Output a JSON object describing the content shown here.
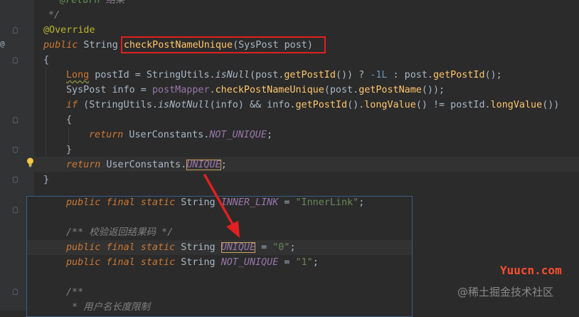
{
  "code": {
    "l0_prefix": "* ",
    "l0_tag": "@return",
    "l0_text": " 结果",
    "l1": "*/",
    "l2_ann": "@Override",
    "l3_kw": "public",
    "l3_type": " String ",
    "l3_method": "checkPostNameUnique",
    "l3_params": "(SysPost post)",
    "l4": "{",
    "l5_type": "Long",
    "l5_a": " postId = StringUtils.",
    "l5_isnull": "isNull",
    "l5_b": "(post.",
    "l5_getpostid1": "getPostId",
    "l5_c": "()) ? ",
    "l5_num": "-1L",
    "l5_d": " : post.",
    "l5_getpostid2": "getPostId",
    "l5_e": "();",
    "l6_a": "SysPost info = ",
    "l6_field": "postMapper",
    "l6_b": ".",
    "l6_method": "checkPostNameUnique",
    "l6_c": "(post.",
    "l6_getname": "getPostName",
    "l6_d": "());",
    "l7_kw": "if",
    "l7_a": " (StringUtils.",
    "l7_isnotnull": "isNotNull",
    "l7_b": "(info) && info.",
    "l7_getpostid": "getPostId",
    "l7_c": "().",
    "l7_long1": "longValue",
    "l7_d": "() != postId.",
    "l7_long2": "longValue",
    "l7_e": "())",
    "l8": "{",
    "l9_kw": "return",
    "l9_a": " UserConstants.",
    "l9_const": "NOT_UNIQUE",
    "l9_b": ";",
    "l10": "}",
    "l11_kw": "return",
    "l11_a": " UserConstants.",
    "l11_const": "UNIQUE",
    "l11_b": ";",
    "l12": "}"
  },
  "popup": {
    "p1_mods": "public final static",
    "p1_type": " String ",
    "p1_name": "INNER_LINK",
    "p1_eq": " = ",
    "p1_val": "\"InnerLink\"",
    "p1_semi": ";",
    "p2_comment": "/** 校验返回结果码 */",
    "p3_mods": "public final static",
    "p3_type": " String ",
    "p3_name": "UNIQUE",
    "p3_eq": " = ",
    "p3_val": "\"0\"",
    "p3_semi": ";",
    "p4_mods": "public final static",
    "p4_type": " String ",
    "p4_name": "NOT_UNIQUE",
    "p4_eq": " = ",
    "p4_val": "\"1\"",
    "p4_semi": ";",
    "p5_comment": "/**",
    "p6_comment": " * 用户名长度限制"
  },
  "gutter": {
    "override_marker": "@"
  },
  "watermarks": {
    "site": "Yuucn.com",
    "juejin": "@稀土掘金技术社区"
  },
  "colors": {
    "annotation_box": "#e02020",
    "arrow": "#e02020",
    "popup_border": "#3a5f8a",
    "watermark_site": "#ff4d2e"
  }
}
